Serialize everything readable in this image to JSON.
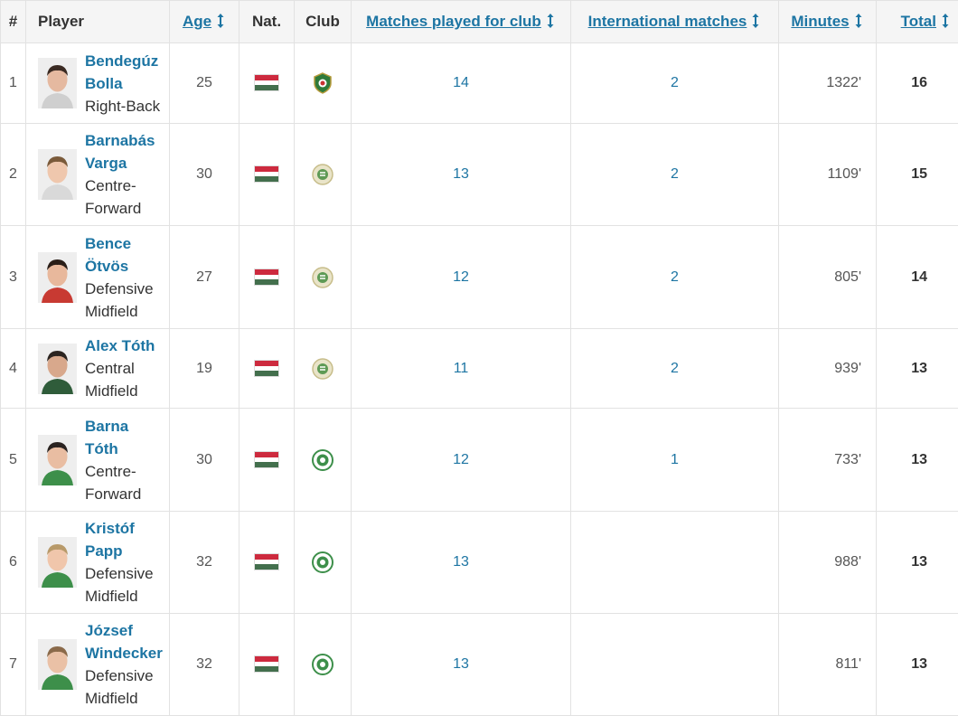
{
  "columns": {
    "index": "#",
    "player": "Player",
    "age": "Age",
    "nat": "Nat.",
    "club": "Club",
    "matches_club": "Matches played for club",
    "international": "International matches",
    "minutes": "Minutes",
    "total": "Total"
  },
  "colors": {
    "link": "#1d75a3",
    "flag_red": "#cd2a3e",
    "flag_green": "#436f4d"
  },
  "rows": [
    {
      "idx": "1",
      "name_line1": "Bendegúz",
      "name_line2": "Bolla",
      "position_line1": "Right-Back",
      "position_line2": "",
      "age": "25",
      "club_icon": "rapid-wien-crest-icon",
      "matches": "14",
      "international": "2",
      "minutes": "1322'",
      "total": "16"
    },
    {
      "idx": "2",
      "name_line1": "Barnabás",
      "name_line2": "Varga",
      "position_line1": "Centre-",
      "position_line2": "Forward",
      "age": "30",
      "club_icon": "ferencvaros-crest-icon",
      "matches": "13",
      "international": "2",
      "minutes": "1109'",
      "total": "15"
    },
    {
      "idx": "3",
      "name_line1": "Bence",
      "name_line2": "Ötvös",
      "position_line1": "Defensive",
      "position_line2": "Midfield",
      "age": "27",
      "club_icon": "ferencvaros-crest-icon",
      "matches": "12",
      "international": "2",
      "minutes": "805'",
      "total": "14"
    },
    {
      "idx": "4",
      "name_line1": "Alex Tóth",
      "name_line2": "",
      "position_line1": "Central",
      "position_line2": "Midfield",
      "age": "19",
      "club_icon": "ferencvaros-crest-icon",
      "matches": "11",
      "international": "2",
      "minutes": "939'",
      "total": "13"
    },
    {
      "idx": "5",
      "name_line1": "Barna",
      "name_line2": "Tóth",
      "position_line1": "Centre-",
      "position_line2": "Forward",
      "age": "30",
      "club_icon": "paks-crest-icon",
      "matches": "12",
      "international": "1",
      "minutes": "733'",
      "total": "13"
    },
    {
      "idx": "6",
      "name_line1": "Kristóf",
      "name_line2": "Papp",
      "position_line1": "Defensive",
      "position_line2": "Midfield",
      "age": "32",
      "club_icon": "paks-crest-icon",
      "matches": "13",
      "international": "",
      "minutes": "988'",
      "total": "13"
    },
    {
      "idx": "7",
      "name_line1": "József",
      "name_line2": "Windecker",
      "position_line1": "Defensive",
      "position_line2": "Midfield",
      "age": "32",
      "club_icon": "paks-crest-icon",
      "matches": "13",
      "international": "",
      "minutes": "811'",
      "total": "13"
    }
  ]
}
